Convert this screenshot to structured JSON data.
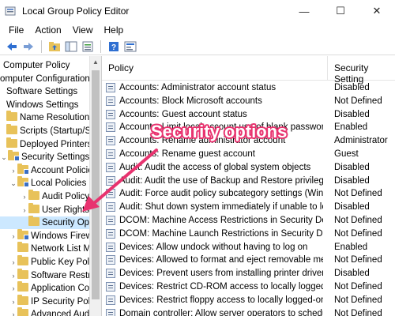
{
  "window": {
    "title": "Local Group Policy Editor",
    "minimize": "—",
    "maximize": "☐",
    "close": "✕"
  },
  "menu": [
    "File",
    "Action",
    "View",
    "Help"
  ],
  "tree": [
    {
      "label": "Computer Policy",
      "chev": "",
      "folder": false,
      "selected": false,
      "indent": 4
    },
    {
      "label": "omputer Configuration",
      "chev": "",
      "folder": false,
      "selected": false,
      "indent": 0
    },
    {
      "label": "Software Settings",
      "chev": "",
      "folder": false,
      "selected": false,
      "indent": 8
    },
    {
      "label": "Windows Settings",
      "chev": "",
      "folder": false,
      "selected": false,
      "indent": 8
    },
    {
      "label": "Name Resolution Po",
      "chev": "",
      "folder": true,
      "selected": false,
      "indent": 8
    },
    {
      "label": "Scripts (Startup/Shut",
      "chev": "",
      "folder": true,
      "selected": false,
      "indent": 8
    },
    {
      "label": "Deployed Printers",
      "chev": "",
      "folder": true,
      "selected": false,
      "indent": 8
    },
    {
      "label": "Security Settings",
      "chev": "⌄",
      "folder": true,
      "lock": true,
      "selected": false,
      "indent": 0
    },
    {
      "label": "Account Policies",
      "chev": "›",
      "folder": true,
      "lock": true,
      "selected": false,
      "indent": 12
    },
    {
      "label": "Local Policies",
      "chev": "⌄",
      "folder": true,
      "lock": true,
      "selected": false,
      "indent": 12
    },
    {
      "label": "Audit Policy",
      "chev": "›",
      "folder": true,
      "selected": false,
      "indent": 26
    },
    {
      "label": "User Rights",
      "chev": "›",
      "folder": true,
      "selected": false,
      "indent": 26
    },
    {
      "label": "Security Optio",
      "chev": "",
      "folder": true,
      "selected": true,
      "indent": 36
    },
    {
      "label": "Windows Firewal",
      "chev": "›",
      "folder": true,
      "lock": true,
      "selected": false,
      "indent": 12
    },
    {
      "label": "Network List Mar",
      "chev": "",
      "folder": true,
      "selected": false,
      "indent": 22
    },
    {
      "label": "Public Key Polici",
      "chev": "›",
      "folder": true,
      "selected": false,
      "indent": 12
    },
    {
      "label": "Software Restrict",
      "chev": "›",
      "folder": true,
      "selected": false,
      "indent": 12
    },
    {
      "label": "Application Cont",
      "chev": "›",
      "folder": true,
      "selected": false,
      "indent": 12
    },
    {
      "label": "IP Security Polici",
      "chev": "›",
      "folder": true,
      "selected": false,
      "indent": 12
    },
    {
      "label": "Advanced Audit",
      "chev": "›",
      "folder": true,
      "selected": false,
      "indent": 12
    }
  ],
  "columns": {
    "policy": "Policy",
    "setting": "Security Setting"
  },
  "rows": [
    {
      "policy": "Accounts: Administrator account status",
      "setting": "Disabled"
    },
    {
      "policy": "Accounts: Block Microsoft accounts",
      "setting": "Not Defined"
    },
    {
      "policy": "Accounts: Guest account status",
      "setting": "Disabled"
    },
    {
      "policy": "Accounts: Limit local account use of blank passwords to co...",
      "setting": "Enabled"
    },
    {
      "policy": "Accounts: Rename administrator account",
      "setting": "Administrator"
    },
    {
      "policy": "Accounts: Rename guest account",
      "setting": "Guest"
    },
    {
      "policy": "Audit: Audit the access of global system objects",
      "setting": "Disabled"
    },
    {
      "policy": "Audit: Audit the use of Backup and Restore privilege",
      "setting": "Disabled"
    },
    {
      "policy": "Audit: Force audit policy subcategory settings (Windows Vis...",
      "setting": "Not Defined"
    },
    {
      "policy": "Audit: Shut down system immediately if unable to log secur...",
      "setting": "Disabled"
    },
    {
      "policy": "DCOM: Machine Access Restrictions in Security Descriptor D...",
      "setting": "Not Defined"
    },
    {
      "policy": "DCOM: Machine Launch Restrictions in Security Descriptor ...",
      "setting": "Not Defined"
    },
    {
      "policy": "Devices: Allow undock without having to log on",
      "setting": "Enabled"
    },
    {
      "policy": "Devices: Allowed to format and eject removable media",
      "setting": "Not Defined"
    },
    {
      "policy": "Devices: Prevent users from installing printer drivers",
      "setting": "Disabled"
    },
    {
      "policy": "Devices: Restrict CD-ROM access to locally logged-on user ...",
      "setting": "Not Defined"
    },
    {
      "policy": "Devices: Restrict floppy access to locally logged-on user only",
      "setting": "Not Defined"
    },
    {
      "policy": "Domain controller: Allow server operators to schedule tasks",
      "setting": "Not Defined"
    }
  ],
  "annotation": {
    "text": "Security options",
    "color": "#e8336f"
  },
  "colors": {
    "folder": "#e8c25a",
    "selection": "#cce8ff",
    "arrow": "#e8336f"
  }
}
